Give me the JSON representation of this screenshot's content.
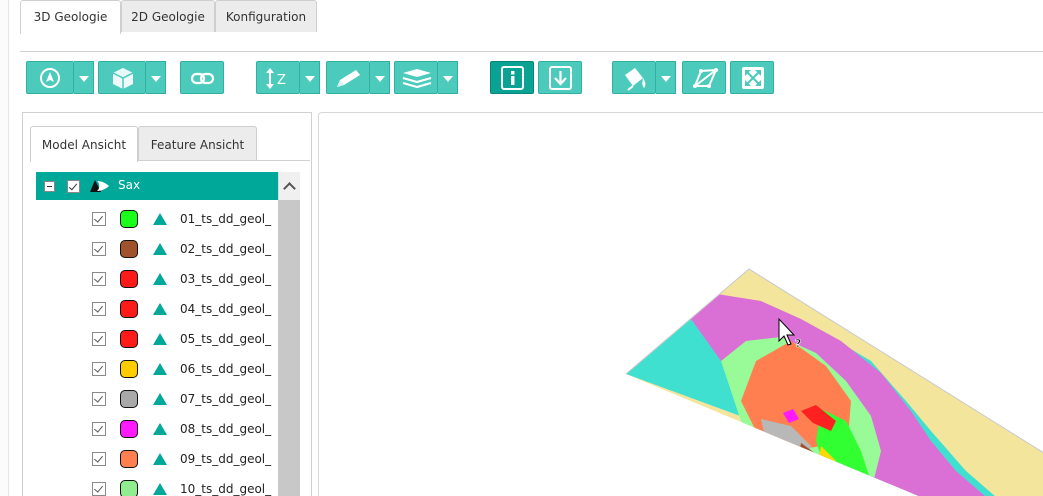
{
  "tabs": [
    {
      "label": "3D Geologie",
      "active": true
    },
    {
      "label": "2D Geologie",
      "active": false
    },
    {
      "label": "Konfiguration",
      "active": false
    }
  ],
  "toolbar": {
    "accent": "#4ccbbd",
    "buttons": [
      {
        "icon": "compass-icon",
        "dropdown": true
      },
      {
        "icon": "cube-icon",
        "dropdown": true
      },
      {
        "icon": "link-icon",
        "dropdown": false
      },
      {
        "icon": "z-scale-icon",
        "label": "Z",
        "dropdown": true
      },
      {
        "icon": "pencil-icon",
        "dropdown": true
      },
      {
        "icon": "layers-icon",
        "dropdown": true
      },
      {
        "icon": "info-icon",
        "dropdown": false,
        "active": true
      },
      {
        "icon": "download-icon",
        "dropdown": false
      },
      {
        "icon": "paint-bucket-icon",
        "dropdown": true
      },
      {
        "icon": "polygon-icon",
        "dropdown": false
      },
      {
        "icon": "fullscreen-icon",
        "dropdown": false
      }
    ]
  },
  "left_panel": {
    "tabs": [
      {
        "label": "Model Ansicht",
        "active": true
      },
      {
        "label": "Feature Ansicht",
        "active": false
      }
    ],
    "tree": {
      "root": {
        "label": "Sax",
        "checked": true,
        "expanded": true
      },
      "items": [
        {
          "label": "01_ts_dd_geol_",
          "color": "#19ff19",
          "checked": true
        },
        {
          "label": "02_ts_dd_geol_",
          "color": "#a0522d",
          "checked": true
        },
        {
          "label": "03_ts_dd_geol_",
          "color": "#ff1a1a",
          "checked": true
        },
        {
          "label": "04_ts_dd_geol_",
          "color": "#ff1a1a",
          "checked": true
        },
        {
          "label": "05_ts_dd_geol_",
          "color": "#ff1a1a",
          "checked": true
        },
        {
          "label": "06_ts_dd_geol_",
          "color": "#ffcc00",
          "checked": true
        },
        {
          "label": "07_ts_dd_geol_",
          "color": "#a9a9a9",
          "checked": true
        },
        {
          "label": "08_ts_dd_geol_",
          "color": "#ff19ff",
          "checked": true
        },
        {
          "label": "09_ts_dd_geol_",
          "color": "#ff7f50",
          "checked": true
        },
        {
          "label": "10_ts_dd_geol_",
          "color": "#90ee90",
          "checked": true
        }
      ]
    }
  },
  "viewport": {
    "cursor": "help-cursor-icon",
    "colors": {
      "khaki": "#f4e59d",
      "orchid": "#da70d6",
      "turquoise": "#40e0d0",
      "coral": "#ff7f50",
      "light_green": "#98fb98",
      "green": "#32ff32",
      "gray": "#a9a9a9",
      "red": "#ff2020",
      "magenta": "#ff19ff",
      "yellow": "#ffd700"
    }
  }
}
